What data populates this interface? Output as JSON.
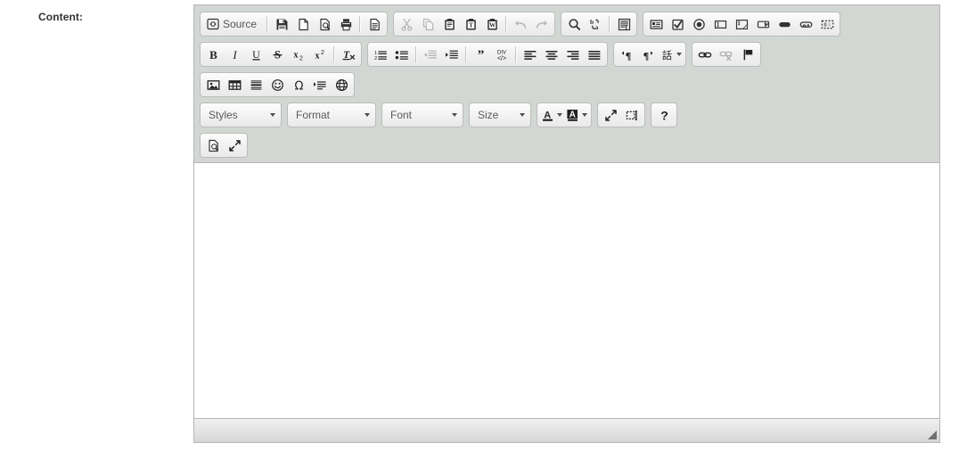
{
  "form": {
    "label": "Content:"
  },
  "editor": {
    "toolbar_rows": [
      {
        "groups": [
          {
            "name": "document",
            "items": [
              {
                "icon": "source-icon",
                "label": "Source",
                "type": "text-button",
                "disabled": false
              },
              {
                "icon": "separator",
                "type": "separator"
              },
              {
                "icon": "save-icon",
                "label": "Save",
                "disabled": false
              },
              {
                "icon": "new-page-icon",
                "label": "New Page",
                "disabled": false
              },
              {
                "icon": "preview-icon",
                "label": "Preview",
                "disabled": false
              },
              {
                "icon": "print-icon",
                "label": "Print",
                "disabled": false
              },
              {
                "icon": "separator",
                "type": "separator"
              },
              {
                "icon": "templates-icon",
                "label": "Templates",
                "disabled": false
              }
            ]
          },
          {
            "name": "clipboard",
            "items": [
              {
                "icon": "cut-icon",
                "label": "Cut",
                "disabled": true
              },
              {
                "icon": "copy-icon",
                "label": "Copy",
                "disabled": true
              },
              {
                "icon": "paste-icon",
                "label": "Paste",
                "disabled": false
              },
              {
                "icon": "paste-text-icon",
                "label": "Paste as plain text",
                "disabled": false
              },
              {
                "icon": "paste-word-icon",
                "label": "Paste from Word",
                "disabled": false
              },
              {
                "icon": "separator",
                "type": "separator"
              },
              {
                "icon": "undo-icon",
                "label": "Undo",
                "disabled": true
              },
              {
                "icon": "redo-icon",
                "label": "Redo",
                "disabled": true
              }
            ]
          },
          {
            "name": "editing",
            "items": [
              {
                "icon": "find-icon",
                "label": "Find",
                "disabled": false
              },
              {
                "icon": "replace-icon",
                "label": "Replace",
                "disabled": false
              },
              {
                "icon": "separator",
                "type": "separator"
              },
              {
                "icon": "select-all-icon",
                "label": "Select All",
                "disabled": false
              }
            ]
          },
          {
            "name": "forms",
            "items": [
              {
                "icon": "form-icon",
                "label": "Form",
                "disabled": false
              },
              {
                "icon": "checkbox-icon",
                "label": "Checkbox",
                "disabled": false
              },
              {
                "icon": "radio-icon",
                "label": "Radio Button",
                "disabled": false
              },
              {
                "icon": "text-field-icon",
                "label": "Text Field",
                "disabled": false
              },
              {
                "icon": "textarea-icon",
                "label": "Textarea",
                "disabled": false
              },
              {
                "icon": "select-field-icon",
                "label": "Selection Field",
                "disabled": false
              },
              {
                "icon": "button-icon",
                "label": "Button",
                "disabled": false
              },
              {
                "icon": "image-button-icon",
                "label": "Image Button",
                "disabled": false
              },
              {
                "icon": "hidden-field-icon",
                "label": "Hidden Field",
                "disabled": false
              }
            ]
          }
        ]
      },
      {
        "groups": [
          {
            "name": "basic-styles",
            "items": [
              {
                "icon": "bold-icon",
                "label": "Bold",
                "disabled": false
              },
              {
                "icon": "italic-icon",
                "label": "Italic",
                "disabled": false
              },
              {
                "icon": "underline-icon",
                "label": "Underline",
                "disabled": false
              },
              {
                "icon": "strike-icon",
                "label": "Strikethrough",
                "disabled": false
              },
              {
                "icon": "subscript-icon",
                "label": "Subscript",
                "disabled": false
              },
              {
                "icon": "superscript-icon",
                "label": "Superscript",
                "disabled": false
              },
              {
                "icon": "separator",
                "type": "separator"
              },
              {
                "icon": "remove-format-icon",
                "label": "Remove Format",
                "disabled": false
              }
            ]
          },
          {
            "name": "paragraph",
            "items": [
              {
                "icon": "numbered-list-icon",
                "label": "Insert/Remove Numbered List",
                "disabled": false
              },
              {
                "icon": "bulleted-list-icon",
                "label": "Insert/Remove Bulleted List",
                "disabled": false
              },
              {
                "icon": "separator",
                "type": "separator"
              },
              {
                "icon": "outdent-icon",
                "label": "Decrease Indent",
                "disabled": true
              },
              {
                "icon": "indent-icon",
                "label": "Increase Indent",
                "disabled": false
              },
              {
                "icon": "separator",
                "type": "separator"
              },
              {
                "icon": "blockquote-icon",
                "label": "Block Quote",
                "disabled": false
              },
              {
                "icon": "create-div-icon",
                "label": "Create Div Container",
                "disabled": false
              },
              {
                "icon": "separator",
                "type": "separator"
              },
              {
                "icon": "align-left-icon",
                "label": "Align Left",
                "disabled": false
              },
              {
                "icon": "align-center-icon",
                "label": "Center",
                "disabled": false
              },
              {
                "icon": "align-right-icon",
                "label": "Align Right",
                "disabled": false
              },
              {
                "icon": "justify-icon",
                "label": "Justify",
                "disabled": false
              }
            ]
          },
          {
            "name": "bidi",
            "items": [
              {
                "icon": "ltr-icon",
                "label": "Text direction from left to right",
                "disabled": false
              },
              {
                "icon": "rtl-icon",
                "label": "Text direction from right to left",
                "disabled": false
              },
              {
                "icon": "language-icon",
                "label": "Set Language",
                "disabled": false,
                "has_arrow": true
              }
            ]
          },
          {
            "name": "links",
            "items": [
              {
                "icon": "link-icon",
                "label": "Link",
                "disabled": false
              },
              {
                "icon": "unlink-icon",
                "label": "Unlink",
                "disabled": true
              },
              {
                "icon": "anchor-icon",
                "label": "Anchor",
                "disabled": false
              }
            ]
          }
        ]
      },
      {
        "groups": [
          {
            "name": "insert",
            "items": [
              {
                "icon": "image-icon",
                "label": "Image",
                "disabled": false
              },
              {
                "icon": "table-icon",
                "label": "Table",
                "disabled": false
              },
              {
                "icon": "horizontal-rule-icon",
                "label": "Insert Horizontal Line",
                "disabled": false
              },
              {
                "icon": "smiley-icon",
                "label": "Smiley",
                "disabled": false
              },
              {
                "icon": "special-char-icon",
                "label": "Insert Special Character",
                "disabled": false
              },
              {
                "icon": "page-break-icon",
                "label": "Insert Page Break for Printing",
                "disabled": false
              },
              {
                "icon": "iframe-icon",
                "label": "IFrame",
                "disabled": false
              }
            ]
          }
        ]
      },
      {
        "combos": [
          {
            "name": "styles-combo",
            "label": "Styles"
          },
          {
            "name": "format-combo",
            "label": "Format"
          },
          {
            "name": "font-combo",
            "label": "Font"
          },
          {
            "name": "size-combo",
            "label": "Size"
          }
        ],
        "groups": [
          {
            "name": "colors",
            "items": [
              {
                "icon": "text-color-icon",
                "label": "Text Color",
                "disabled": false,
                "has_arrow": true
              },
              {
                "icon": "bg-color-icon",
                "label": "Background Color",
                "disabled": false,
                "has_arrow": true
              }
            ]
          },
          {
            "name": "tools",
            "items": [
              {
                "icon": "maximize-icon",
                "label": "Maximize",
                "disabled": false
              },
              {
                "icon": "show-blocks-icon",
                "label": "Show Blocks",
                "disabled": false
              }
            ]
          },
          {
            "name": "about",
            "items": [
              {
                "icon": "help-icon",
                "label": "About CKEditor",
                "disabled": false
              }
            ]
          }
        ]
      },
      {
        "groups": [
          {
            "name": "mode",
            "items": [
              {
                "icon": "preview-icon",
                "label": "Preview",
                "disabled": false
              },
              {
                "icon": "maximize-icon",
                "label": "Maximize",
                "disabled": false
              }
            ]
          }
        ]
      }
    ],
    "content": {
      "value": "",
      "placeholder": ""
    },
    "statusbar": {
      "path": "",
      "resize_grip": "resize-handle"
    }
  },
  "colors": {
    "toolbar_bg": "#d3d7d3",
    "editor_border": "#b6b6b6",
    "content_bg": "#ffffff",
    "label_text": "#333333",
    "button_text": "#222222"
  }
}
